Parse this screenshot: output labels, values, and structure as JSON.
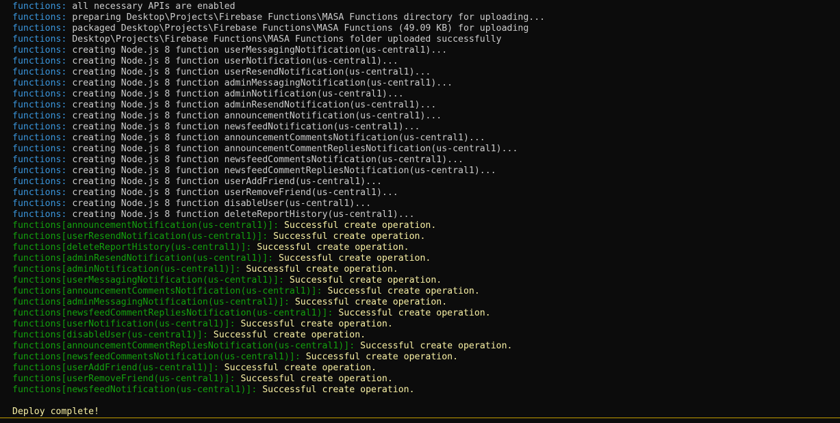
{
  "colors": {
    "background": "#0c0c0c",
    "cyan_prefix": "#3a96dd",
    "green_prefix": "#13a10e",
    "white_text": "#cccccc",
    "yellow_text": "#f9f1a5",
    "rule": "#c19c00"
  },
  "cyan_lines": [
    {
      "prefix": "functions:",
      "message": " all necessary APIs are enabled"
    },
    {
      "prefix": "functions:",
      "message": " preparing Desktop\\Projects\\Firebase Functions\\MASA Functions directory for uploading..."
    },
    {
      "prefix": "functions:",
      "message": " packaged Desktop\\Projects\\Firebase Functions\\MASA Functions (49.09 KB) for uploading"
    },
    {
      "prefix": "functions:",
      "message": " Desktop\\Projects\\Firebase Functions\\MASA Functions folder uploaded successfully"
    },
    {
      "prefix": "functions:",
      "message": " creating Node.js 8 function userMessagingNotification(us-central1)..."
    },
    {
      "prefix": "functions:",
      "message": " creating Node.js 8 function userNotification(us-central1)..."
    },
    {
      "prefix": "functions:",
      "message": " creating Node.js 8 function userResendNotification(us-central1)..."
    },
    {
      "prefix": "functions:",
      "message": " creating Node.js 8 function adminMessagingNotification(us-central1)..."
    },
    {
      "prefix": "functions:",
      "message": " creating Node.js 8 function adminNotification(us-central1)..."
    },
    {
      "prefix": "functions:",
      "message": " creating Node.js 8 function adminResendNotification(us-central1)..."
    },
    {
      "prefix": "functions:",
      "message": " creating Node.js 8 function announcementNotification(us-central1)..."
    },
    {
      "prefix": "functions:",
      "message": " creating Node.js 8 function newsfeedNotification(us-central1)..."
    },
    {
      "prefix": "functions:",
      "message": " creating Node.js 8 function announcementCommentsNotification(us-central1)..."
    },
    {
      "prefix": "functions:",
      "message": " creating Node.js 8 function announcementCommentRepliesNotification(us-central1)..."
    },
    {
      "prefix": "functions:",
      "message": " creating Node.js 8 function newsfeedCommentsNotification(us-central1)..."
    },
    {
      "prefix": "functions:",
      "message": " creating Node.js 8 function newsfeedCommentRepliesNotification(us-central1)..."
    },
    {
      "prefix": "functions:",
      "message": " creating Node.js 8 function userAddFriend(us-central1)..."
    },
    {
      "prefix": "functions:",
      "message": " creating Node.js 8 function userRemoveFriend(us-central1)..."
    },
    {
      "prefix": "functions:",
      "message": " creating Node.js 8 function disableUser(us-central1)..."
    },
    {
      "prefix": "functions:",
      "message": " creating Node.js 8 function deleteReportHistory(us-central1)..."
    }
  ],
  "green_lines": [
    {
      "prefix": "functions[announcementNotification(us-central1)]:",
      "message": " Successful create operation."
    },
    {
      "prefix": "functions[userResendNotification(us-central1)]:",
      "message": " Successful create operation."
    },
    {
      "prefix": "functions[deleteReportHistory(us-central1)]:",
      "message": " Successful create operation."
    },
    {
      "prefix": "functions[adminResendNotification(us-central1)]:",
      "message": " Successful create operation."
    },
    {
      "prefix": "functions[adminNotification(us-central1)]:",
      "message": " Successful create operation."
    },
    {
      "prefix": "functions[userMessagingNotification(us-central1)]:",
      "message": " Successful create operation."
    },
    {
      "prefix": "functions[announcementCommentsNotification(us-central1)]:",
      "message": " Successful create operation."
    },
    {
      "prefix": "functions[adminMessagingNotification(us-central1)]:",
      "message": " Successful create operation."
    },
    {
      "prefix": "functions[newsfeedCommentRepliesNotification(us-central1)]:",
      "message": " Successful create operation."
    },
    {
      "prefix": "functions[userNotification(us-central1)]:",
      "message": " Successful create operation."
    },
    {
      "prefix": "functions[disableUser(us-central1)]:",
      "message": " Successful create operation."
    },
    {
      "prefix": "functions[announcementCommentRepliesNotification(us-central1)]:",
      "message": " Successful create operation."
    },
    {
      "prefix": "functions[newsfeedCommentsNotification(us-central1)]:",
      "message": " Successful create operation."
    },
    {
      "prefix": "functions[userAddFriend(us-central1)]:",
      "message": " Successful create operation."
    },
    {
      "prefix": "functions[userRemoveFriend(us-central1)]:",
      "message": " Successful create operation."
    },
    {
      "prefix": "functions[newsfeedNotification(us-central1)]:",
      "message": " Successful create operation."
    }
  ],
  "deploy_message": "Deploy complete!"
}
